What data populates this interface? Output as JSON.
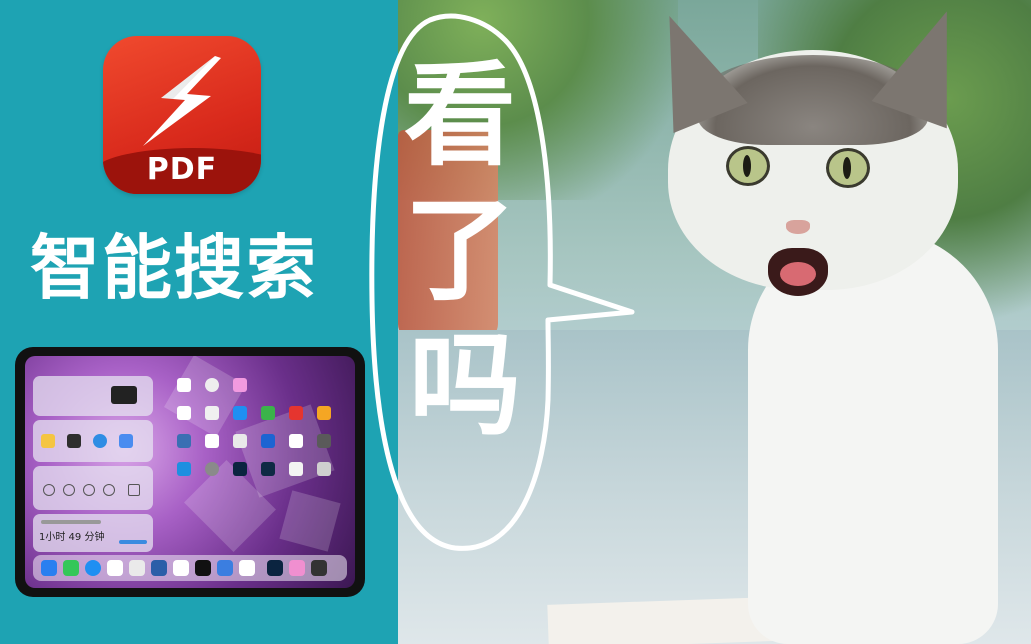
{
  "left": {
    "app_icon_label": "PDF",
    "headline": "智能搜索",
    "background": "#1ea3b3"
  },
  "tablet": {
    "widget_duration": "1小时 49 分钟"
  },
  "bubble": {
    "text_chars": [
      "看",
      "了",
      "吗"
    ]
  },
  "icons": {
    "app": "lightning-bolt-icon"
  },
  "colors": {
    "accent_red": "#d92a1c",
    "teal": "#1ea3b3",
    "white": "#ffffff"
  }
}
